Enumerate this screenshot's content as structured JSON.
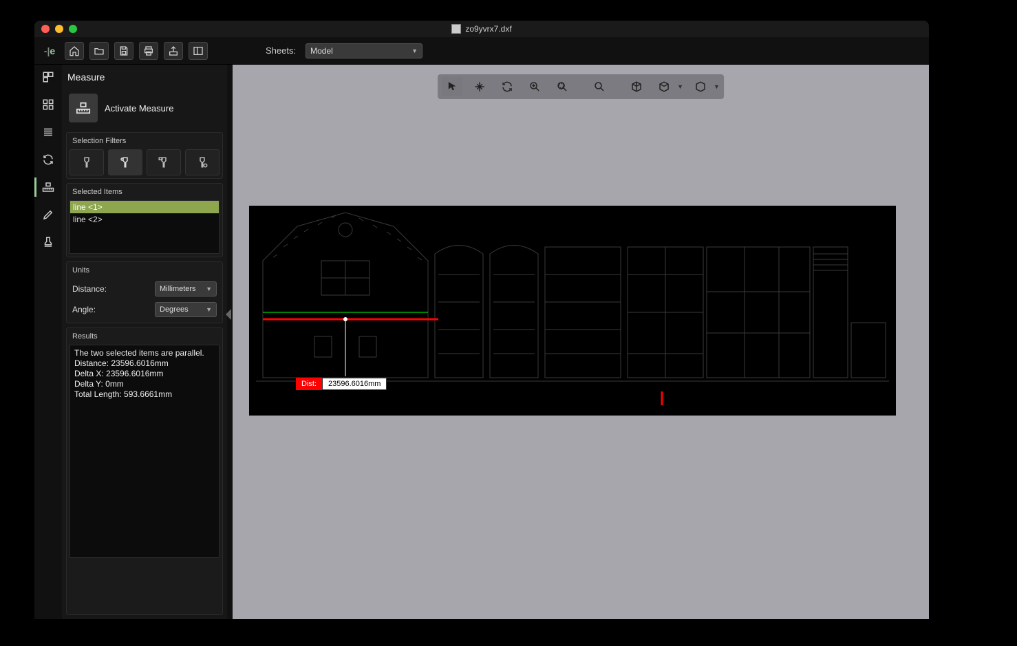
{
  "window": {
    "filename": "zo9yvrx7.dxf"
  },
  "toolbar": {
    "sheets_label": "Sheets:",
    "sheets_value": "Model"
  },
  "panel": {
    "title": "Measure",
    "activate_label": "Activate Measure",
    "filters_title": "Selection Filters",
    "selected_title": "Selected Items",
    "selected_items": [
      "line <1>",
      "line <2>"
    ],
    "units_title": "Units",
    "distance_label": "Distance:",
    "distance_unit": "Millimeters",
    "angle_label": "Angle:",
    "angle_unit": "Degrees",
    "results_title": "Results",
    "results_text": "The two selected items are parallel.\nDistance: 23596.6016mm\n  Delta X: 23596.6016mm\n  Delta Y: 0mm\nTotal Length: 593.6661mm"
  },
  "measure": {
    "label": "Dist:",
    "value": "23596.6016mm"
  }
}
